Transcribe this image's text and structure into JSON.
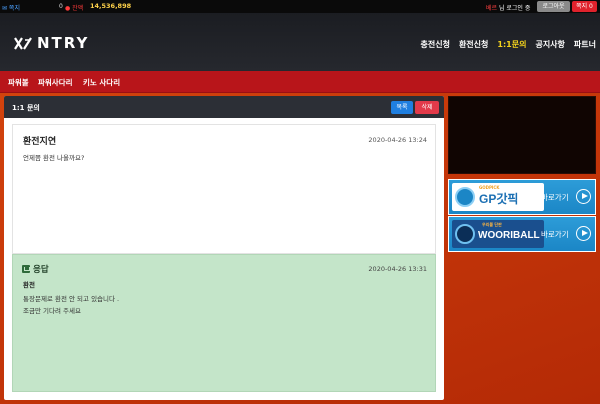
{
  "topbar": {
    "mail_label": "✉ 쪽지",
    "mail_count": "0",
    "coin_label": "● 잔액",
    "money": "14,536,898",
    "user_name": "베르",
    "user_suffix": "님 로그인 중",
    "logout": "로그아웃",
    "note": "쪽지 0"
  },
  "header": {
    "logo_text": "NTRY",
    "nav": [
      "충전신청",
      "환전신청",
      "1:1문의",
      "공지사항",
      "파트너"
    ],
    "active_nav": "1:1문의"
  },
  "menu": [
    "파워볼",
    "파워사다리",
    "키노 사다리"
  ],
  "panel": {
    "title": "1:1 문의",
    "list_button": "목록",
    "delete_button": "삭제"
  },
  "question": {
    "title": "환전지연",
    "date": "2020-04-26 13:24",
    "body": "언제쯤 환전 나올까요?"
  },
  "answer": {
    "title": "응답",
    "date": "2020-04-26 13:31",
    "subject": "환전",
    "line1": "통장문제로 환전 안 되고 있습니다 .",
    "line2": "조금만 기다려 주세요"
  },
  "banners": [
    {
      "brand": "GP갓픽",
      "small": "GODPICK",
      "go": "바로가기"
    },
    {
      "brand": "WOORIBALL",
      "small": "우리볼 단판",
      "go": "바로가기"
    }
  ],
  "colors": {
    "accent_yellow": "#f3d21c",
    "menu_red": "#b8151a",
    "answer_green": "#c4e5c9",
    "banner_blue": "#1b86c6"
  }
}
